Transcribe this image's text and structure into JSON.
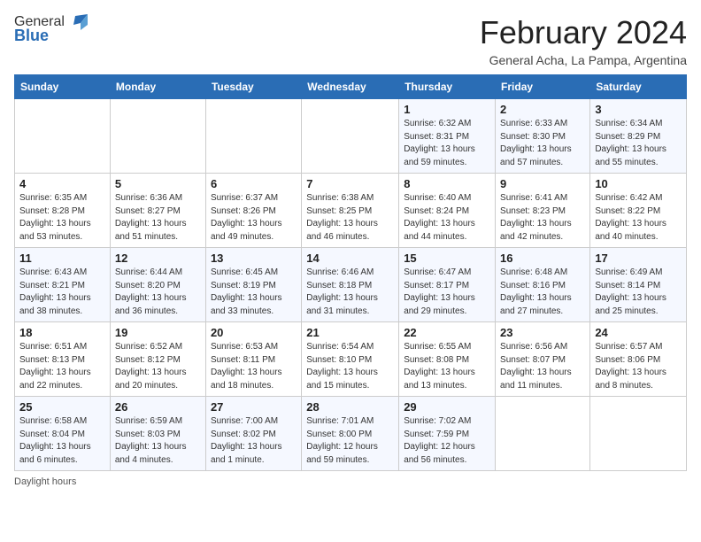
{
  "header": {
    "logo_general": "General",
    "logo_blue": "Blue",
    "month_title": "February 2024",
    "location": "General Acha, La Pampa, Argentina"
  },
  "days_of_week": [
    "Sunday",
    "Monday",
    "Tuesday",
    "Wednesday",
    "Thursday",
    "Friday",
    "Saturday"
  ],
  "footer": {
    "daylight_label": "Daylight hours"
  },
  "weeks": [
    [
      {
        "day": "",
        "info": ""
      },
      {
        "day": "",
        "info": ""
      },
      {
        "day": "",
        "info": ""
      },
      {
        "day": "",
        "info": ""
      },
      {
        "day": "1",
        "info": "Sunrise: 6:32 AM\nSunset: 8:31 PM\nDaylight: 13 hours and 59 minutes."
      },
      {
        "day": "2",
        "info": "Sunrise: 6:33 AM\nSunset: 8:30 PM\nDaylight: 13 hours and 57 minutes."
      },
      {
        "day": "3",
        "info": "Sunrise: 6:34 AM\nSunset: 8:29 PM\nDaylight: 13 hours and 55 minutes."
      }
    ],
    [
      {
        "day": "4",
        "info": "Sunrise: 6:35 AM\nSunset: 8:28 PM\nDaylight: 13 hours and 53 minutes."
      },
      {
        "day": "5",
        "info": "Sunrise: 6:36 AM\nSunset: 8:27 PM\nDaylight: 13 hours and 51 minutes."
      },
      {
        "day": "6",
        "info": "Sunrise: 6:37 AM\nSunset: 8:26 PM\nDaylight: 13 hours and 49 minutes."
      },
      {
        "day": "7",
        "info": "Sunrise: 6:38 AM\nSunset: 8:25 PM\nDaylight: 13 hours and 46 minutes."
      },
      {
        "day": "8",
        "info": "Sunrise: 6:40 AM\nSunset: 8:24 PM\nDaylight: 13 hours and 44 minutes."
      },
      {
        "day": "9",
        "info": "Sunrise: 6:41 AM\nSunset: 8:23 PM\nDaylight: 13 hours and 42 minutes."
      },
      {
        "day": "10",
        "info": "Sunrise: 6:42 AM\nSunset: 8:22 PM\nDaylight: 13 hours and 40 minutes."
      }
    ],
    [
      {
        "day": "11",
        "info": "Sunrise: 6:43 AM\nSunset: 8:21 PM\nDaylight: 13 hours and 38 minutes."
      },
      {
        "day": "12",
        "info": "Sunrise: 6:44 AM\nSunset: 8:20 PM\nDaylight: 13 hours and 36 minutes."
      },
      {
        "day": "13",
        "info": "Sunrise: 6:45 AM\nSunset: 8:19 PM\nDaylight: 13 hours and 33 minutes."
      },
      {
        "day": "14",
        "info": "Sunrise: 6:46 AM\nSunset: 8:18 PM\nDaylight: 13 hours and 31 minutes."
      },
      {
        "day": "15",
        "info": "Sunrise: 6:47 AM\nSunset: 8:17 PM\nDaylight: 13 hours and 29 minutes."
      },
      {
        "day": "16",
        "info": "Sunrise: 6:48 AM\nSunset: 8:16 PM\nDaylight: 13 hours and 27 minutes."
      },
      {
        "day": "17",
        "info": "Sunrise: 6:49 AM\nSunset: 8:14 PM\nDaylight: 13 hours and 25 minutes."
      }
    ],
    [
      {
        "day": "18",
        "info": "Sunrise: 6:51 AM\nSunset: 8:13 PM\nDaylight: 13 hours and 22 minutes."
      },
      {
        "day": "19",
        "info": "Sunrise: 6:52 AM\nSunset: 8:12 PM\nDaylight: 13 hours and 20 minutes."
      },
      {
        "day": "20",
        "info": "Sunrise: 6:53 AM\nSunset: 8:11 PM\nDaylight: 13 hours and 18 minutes."
      },
      {
        "day": "21",
        "info": "Sunrise: 6:54 AM\nSunset: 8:10 PM\nDaylight: 13 hours and 15 minutes."
      },
      {
        "day": "22",
        "info": "Sunrise: 6:55 AM\nSunset: 8:08 PM\nDaylight: 13 hours and 13 minutes."
      },
      {
        "day": "23",
        "info": "Sunrise: 6:56 AM\nSunset: 8:07 PM\nDaylight: 13 hours and 11 minutes."
      },
      {
        "day": "24",
        "info": "Sunrise: 6:57 AM\nSunset: 8:06 PM\nDaylight: 13 hours and 8 minutes."
      }
    ],
    [
      {
        "day": "25",
        "info": "Sunrise: 6:58 AM\nSunset: 8:04 PM\nDaylight: 13 hours and 6 minutes."
      },
      {
        "day": "26",
        "info": "Sunrise: 6:59 AM\nSunset: 8:03 PM\nDaylight: 13 hours and 4 minutes."
      },
      {
        "day": "27",
        "info": "Sunrise: 7:00 AM\nSunset: 8:02 PM\nDaylight: 13 hours and 1 minute."
      },
      {
        "day": "28",
        "info": "Sunrise: 7:01 AM\nSunset: 8:00 PM\nDaylight: 12 hours and 59 minutes."
      },
      {
        "day": "29",
        "info": "Sunrise: 7:02 AM\nSunset: 7:59 PM\nDaylight: 12 hours and 56 minutes."
      },
      {
        "day": "",
        "info": ""
      },
      {
        "day": "",
        "info": ""
      }
    ]
  ]
}
